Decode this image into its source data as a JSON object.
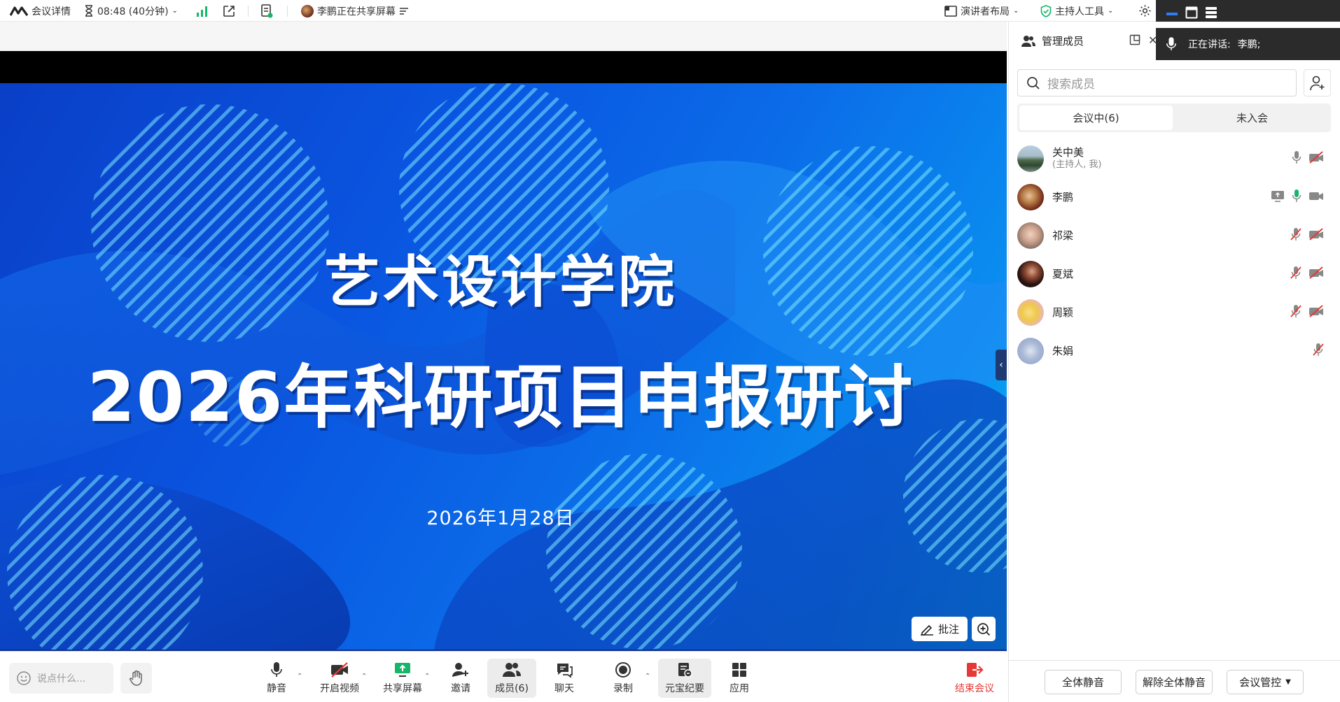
{
  "topbar": {
    "meeting_details": "会议详情",
    "timer": "08:48 (40分钟)",
    "sharing_status": "李鹏正在共享屏幕",
    "presenter_layout": "演讲者布局",
    "host_tools": "主持人工具"
  },
  "slide": {
    "title_line1": "艺术设计学院",
    "title_line2": "2026年科研项目申报研讨",
    "date": "2026年1月28日"
  },
  "overlay": {
    "annotate_label": "批注"
  },
  "chat": {
    "placeholder": "说点什么..."
  },
  "toolbar": {
    "mute": "静音",
    "start_video": "开启视频",
    "share_screen": "共享屏幕",
    "invite": "邀请",
    "members": "成员(6)",
    "chat": "聊天",
    "record": "录制",
    "ai_minutes": "元宝纪要",
    "apps": "应用",
    "end_meeting": "结束会议"
  },
  "panel": {
    "title": "管理成员",
    "speaking_label": "正在讲话:",
    "speaking_name": "李鹏;",
    "search_placeholder": "搜索成员",
    "tab_in_meeting": "会议中(6)",
    "tab_not_joined": "未入会",
    "members": [
      {
        "name": "关中美",
        "role": "(主持人, 我)"
      },
      {
        "name": "李鹏",
        "role": ""
      },
      {
        "name": "祁梁",
        "role": ""
      },
      {
        "name": "夏斌",
        "role": ""
      },
      {
        "name": "周颖",
        "role": ""
      },
      {
        "name": "朱娟",
        "role": ""
      }
    ],
    "mute_all": "全体静音",
    "unmute_all": "解除全体静音",
    "meeting_control": "会议管控"
  },
  "colors": {
    "accent_green": "#16b56a",
    "muted_red": "#e53935",
    "end_red": "#e53935",
    "slide_blue": "#0a55e0"
  }
}
